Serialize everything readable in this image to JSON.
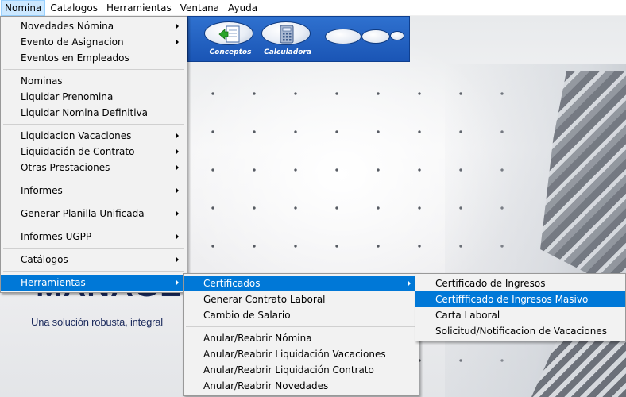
{
  "colors": {
    "menu_highlight": "#0078d7",
    "menubar_active": "#cce8ff",
    "toolbar_blue": "#1a55b5",
    "brand_navy": "#1b2a5c"
  },
  "menubar": {
    "items": [
      "Nomina",
      "Catalogos",
      "Herramientas",
      "Ventana",
      "Ayuda"
    ],
    "active": "Nomina"
  },
  "toolbar": {
    "buttons": [
      {
        "label": "Conceptos",
        "icon": "document-arrow-icon"
      },
      {
        "label": "Calculadora",
        "icon": "calculator-icon"
      }
    ]
  },
  "background": {
    "brand": "MANAGE",
    "tagline": "Una solución robusta, integral"
  },
  "menu_nomina": {
    "groups": [
      [
        {
          "label": "Novedades Nómina",
          "submenu": true
        },
        {
          "label": "Evento de Asignacion",
          "submenu": true
        },
        {
          "label": "Eventos en Empleados",
          "submenu": false
        }
      ],
      [
        {
          "label": "Nominas",
          "submenu": false
        },
        {
          "label": "Liquidar Prenomina",
          "submenu": false
        },
        {
          "label": "Liquidar Nomina Definitiva",
          "submenu": false
        }
      ],
      [
        {
          "label": "Liquidacion Vacaciones",
          "submenu": true
        },
        {
          "label": "Liquidación de Contrato",
          "submenu": true
        },
        {
          "label": "Otras Prestaciones",
          "submenu": true
        }
      ],
      [
        {
          "label": "Informes",
          "submenu": true
        }
      ],
      [
        {
          "label": "Generar Planilla Unificada",
          "submenu": true
        }
      ],
      [
        {
          "label": "Informes UGPP",
          "submenu": true
        }
      ],
      [
        {
          "label": "Catálogos",
          "submenu": true
        }
      ],
      [
        {
          "label": "Herramientas",
          "submenu": true,
          "highlighted": true
        }
      ]
    ]
  },
  "menu_herramientas": {
    "groups": [
      [
        {
          "label": "Certificados",
          "submenu": true,
          "highlighted": true
        },
        {
          "label": "Generar Contrato Laboral",
          "submenu": false
        },
        {
          "label": "Cambio de Salario",
          "submenu": false
        }
      ],
      [
        {
          "label": "Anular/Reabrir Nómina",
          "submenu": false
        },
        {
          "label": "Anular/Reabrir Liquidación Vacaciones",
          "submenu": false
        },
        {
          "label": "Anular/Reabrir Liquidación Contrato",
          "submenu": false
        },
        {
          "label": "Anular/Reabrir Novedades",
          "submenu": false
        }
      ]
    ]
  },
  "menu_certificados": {
    "groups": [
      [
        {
          "label": "Certificado de Ingresos",
          "submenu": false
        },
        {
          "label": "Certiffficado de Ingresos Masivo",
          "submenu": false,
          "highlighted": true
        },
        {
          "label": "Carta Laboral",
          "submenu": false
        },
        {
          "label": "Solicitud/Notificacion de Vacaciones",
          "submenu": false
        }
      ]
    ]
  }
}
